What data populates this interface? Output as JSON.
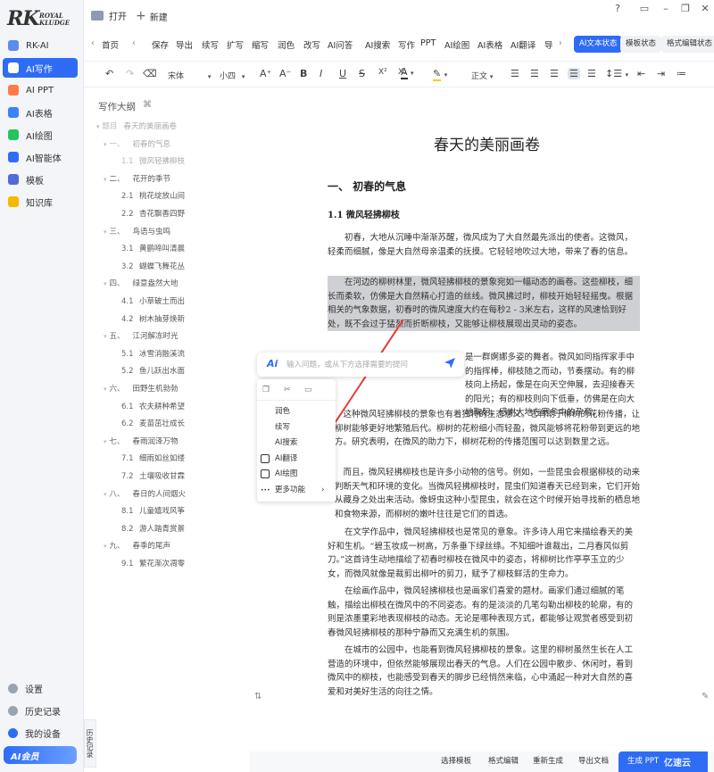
{
  "brand": {
    "logo_rk": "RK",
    "logo_line1": "ROYAL",
    "logo_line2": "KLUDGE"
  },
  "sidebar": {
    "items": [
      {
        "label": "RK-AI",
        "icon": "rk-ai-icon",
        "color": "#5b8def"
      },
      {
        "label": "AI写作",
        "icon": "write-icon",
        "color": "#2f6cf6",
        "active": true
      },
      {
        "label": "AI PPT",
        "icon": "ppt-icon",
        "color": "#ff7a45"
      },
      {
        "label": "AI表格",
        "icon": "table-icon",
        "color": "#3b82f6"
      },
      {
        "label": "AI绘图",
        "icon": "draw-icon",
        "color": "#22c55e"
      },
      {
        "label": "AI智能体",
        "icon": "agent-icon",
        "color": "#2f6cf6"
      },
      {
        "label": "模板",
        "icon": "template-icon",
        "color": "#4f6bd6"
      },
      {
        "label": "知识库",
        "icon": "knowledge-icon",
        "color": "#f5b800"
      }
    ],
    "bottom": [
      {
        "label": "设置",
        "icon": "settings-icon"
      },
      {
        "label": "历史记录",
        "icon": "history-icon"
      },
      {
        "label": "我的设备",
        "icon": "device-icon"
      }
    ],
    "vip": "AI会员"
  },
  "tabs": {
    "open": "打开",
    "new": "新建"
  },
  "menu": {
    "home": "首页",
    "items": [
      "保存",
      "导出",
      "续写",
      "扩写",
      "缩写",
      "润色",
      "改写",
      "AI问答",
      "AI搜索",
      "写作",
      "PPT",
      "AI绘图",
      "AI表格",
      "AI翻译",
      "导"
    ],
    "modes": [
      "AI文本状态",
      "模板状态",
      "格式编辑状态"
    ]
  },
  "format": {
    "font": "宋体",
    "size": "小四",
    "body": "正文"
  },
  "outline": {
    "title": "写作大纲",
    "items": [
      {
        "num": "题目",
        "text": "春天的美丽画卷",
        "level": 0,
        "dim": true
      },
      {
        "num": "一、",
        "text": "初春的气息",
        "level": 1,
        "dim": true
      },
      {
        "num": "1.1",
        "text": "微风轻拂柳枝",
        "level": 2,
        "dim": true
      },
      {
        "num": "二、",
        "text": "花开的季节",
        "level": 1
      },
      {
        "num": "2.1",
        "text": "桃花绽放山间",
        "level": 2
      },
      {
        "num": "2.2",
        "text": "杏花飘香四野",
        "level": 2
      },
      {
        "num": "三、",
        "text": "鸟语与虫鸣",
        "level": 1
      },
      {
        "num": "3.1",
        "text": "黄鹂啼叫清晨",
        "level": 2
      },
      {
        "num": "3.2",
        "text": "蝴蝶飞舞花丛",
        "level": 2
      },
      {
        "num": "四、",
        "text": "绿意盎然大地",
        "level": 1
      },
      {
        "num": "4.1",
        "text": "小草破土而出",
        "level": 2
      },
      {
        "num": "4.2",
        "text": "树木抽芽焕新",
        "level": 2
      },
      {
        "num": "五、",
        "text": "江河解冻时光",
        "level": 1
      },
      {
        "num": "5.1",
        "text": "冰雪消融溪流",
        "level": 2
      },
      {
        "num": "5.2",
        "text": "鱼儿跃出水面",
        "level": 2
      },
      {
        "num": "六、",
        "text": "田野生机勃勃",
        "level": 1
      },
      {
        "num": "6.1",
        "text": "农夫耕种希望",
        "level": 2
      },
      {
        "num": "6.2",
        "text": "麦苗茁壮成长",
        "level": 2
      },
      {
        "num": "七、",
        "text": "春雨润泽万物",
        "level": 1
      },
      {
        "num": "7.1",
        "text": "细雨如丝如缕",
        "level": 2
      },
      {
        "num": "7.2",
        "text": "土壤吸收甘霖",
        "level": 2
      },
      {
        "num": "八、",
        "text": "春日的人间烟火",
        "level": 1
      },
      {
        "num": "8.1",
        "text": "儿童嬉戏风筝",
        "level": 2
      },
      {
        "num": "8.2",
        "text": "游人踏青赏景",
        "level": 2
      },
      {
        "num": "九、",
        "text": "春季的尾声",
        "level": 1
      },
      {
        "num": "9.1",
        "text": "繁花渐次凋零",
        "level": 2
      }
    ],
    "history_tab": "历史记录"
  },
  "doc": {
    "title": "春天的美丽画卷",
    "h1": "一、 初春的气息",
    "h2": "1.1 微风轻拂柳枝",
    "paragraphs": [
      "初春，大地从沉睡中渐渐苏醒，微风成为了大自然最先派出的使者。这微风，轻柔而细腻，像是大自然母亲温柔的抚摸。它轻轻地吹过大地，带来了春的信息。",
      "在河边的柳树林里，微风轻拂柳枝的景象宛如一幅动态的画卷。这些柳枝，细长而柔软，仿佛是大自然精心打造的丝线。微风拂过时，柳枝开始轻轻摇曳。根据相关的气象数据，初春时的微风速度大约在每秒2 - 3米左右，这样的风速恰到好处，既不会过于猛烈而折断柳枝，又能够让柳枝展现出灵动的姿态。",
      "是一群婀娜多姿的舞者。微风如同指挥家手中的指挥棒，柳枝随之而动，节奏摆动。有的柳枝向上扬起，像是在向天空伸展，去迎接春天的阳光；有的柳枝则向下低垂，仿佛是在向大地鞠躬，感谢大地在寒冬中的孕育。",
      "这种微风轻拂柳枝的景象也有着独特的生态意义。它有助于柳树的花粉传播，让柳树能够更好地繁殖后代。柳树的花粉细小而轻盈，微风能够将花粉带到更远的地方。研究表明，在微风的助力下，柳树花粉的传播范围可以达到数里之远。",
      "而且，微风轻拂柳枝也是许多小动物的信号。例如，一些昆虫会根据柳枝的动来判断天气和环境的变化。当微风轻拂柳枝时，昆虫们知道春天已经到来，它们开始从藏身之处出来活动。像蚜虫这种小型昆虫，就会在这个时候开始寻找新的栖息地和食物来源，而柳树的嫩叶往往是它们的首选。",
      "在文学作品中，微风轻拂柳枝也是常见的意象。许多诗人用它来描绘春天的美好和生机。“碧玉妆成一树高，万条垂下绿丝绦。不知细叶谁裁出，二月春风似剪刀。”这首诗生动地描绘了初春时柳枝在微风中的姿态，将柳树比作亭亭玉立的少女，而微风就像是裁剪出柳叶的剪刀，赋予了柳枝鲜活的生命力。",
      "在绘画作品中，微风轻拂柳枝也是画家们喜爱的题材。画家们通过细腻的笔触，描绘出柳枝在微风中的不同姿态。有的是淡淡的几笔勾勒出柳枝的轮廓，有的则是浓墨重彩地表现柳枝的动态。无论是哪种表现方式，都能够让观赏者感受到初春微风轻拂柳枝的那种宁静而又充满生机的氛围。",
      "在城市的公园中，也能看到微风轻拂柳枝的景象。这里的柳树虽然生长在人工营造的环境中，但依然能够展现出春天的气息。人们在公园中散步、休闲时，看到微风中的柳枝，也能感受到春天的脚步已经悄然来临，心中涌起一种对大自然的喜爱和对美好生活的向往之情。"
    ]
  },
  "popup": {
    "ai_logo": "Ai",
    "placeholder": "输入问题，或从下方选择需要的提问",
    "items": [
      "润色",
      "续写",
      "AI搜索",
      "AI翻译",
      "AI绘图",
      "更多功能"
    ]
  },
  "bottom": {
    "buttons": [
      "选择模板",
      "格式编辑",
      "重新生成",
      "导出文档"
    ],
    "primary": "生成 PPT"
  },
  "watermark": "亿速云"
}
